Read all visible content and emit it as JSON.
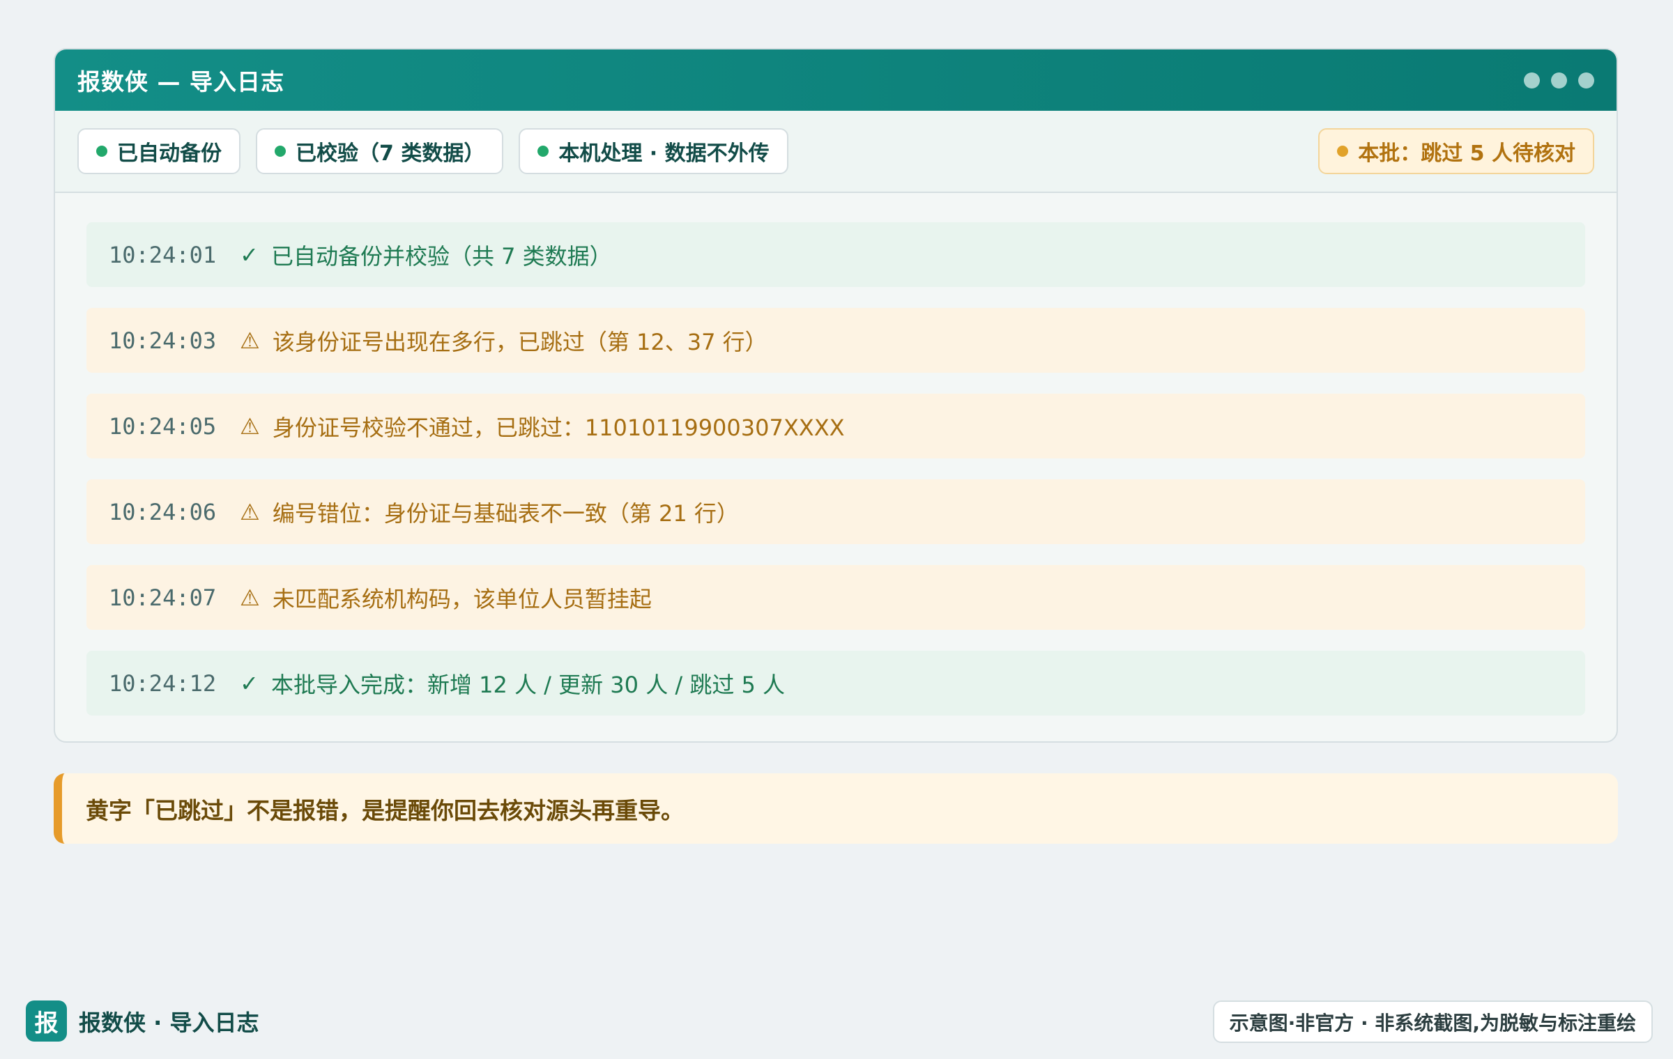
{
  "window": {
    "title": "报数侠 — 导入日志"
  },
  "status_pills": [
    {
      "label": "已自动备份"
    },
    {
      "label": "已校验（7 类数据）"
    },
    {
      "label": "本机处理 · 数据不外传"
    }
  ],
  "batch_pill": {
    "label": "本批：跳过 5 人待核对"
  },
  "log": [
    {
      "time": "10:24:01",
      "icon": "✓",
      "type": "ok",
      "message": "已自动备份并校验（共 7 类数据）"
    },
    {
      "time": "10:24:03",
      "icon": "⚠",
      "type": "warn",
      "message": "该身份证号出现在多行，已跳过（第 12、37 行）"
    },
    {
      "time": "10:24:05",
      "icon": "⚠",
      "type": "warn",
      "message": "身份证号校验不通过，已跳过：11010119900307XXXX"
    },
    {
      "time": "10:24:06",
      "icon": "⚠",
      "type": "warn",
      "message": "编号错位：身份证与基础表不一致（第 21 行）"
    },
    {
      "time": "10:24:07",
      "icon": "⚠",
      "type": "warn",
      "message": "未匹配系统机构码，该单位人员暂挂起"
    },
    {
      "time": "10:24:12",
      "icon": "✓",
      "type": "ok",
      "message": "本批导入完成：新增 12 人 / 更新 30 人 / 跳过 5 人"
    }
  ],
  "note": "黄字「已跳过」不是报错，是提醒你回去核对源头再重导。",
  "footer": {
    "badge": "报",
    "brand": "报数侠 · 导入日志",
    "disclaimer": "示意图·非官方 · 非系统截图,为脱敏与标注重绘"
  },
  "colors": {
    "primary": "#138e87",
    "ok": "#22a86b",
    "warn": "#e1a22a"
  }
}
